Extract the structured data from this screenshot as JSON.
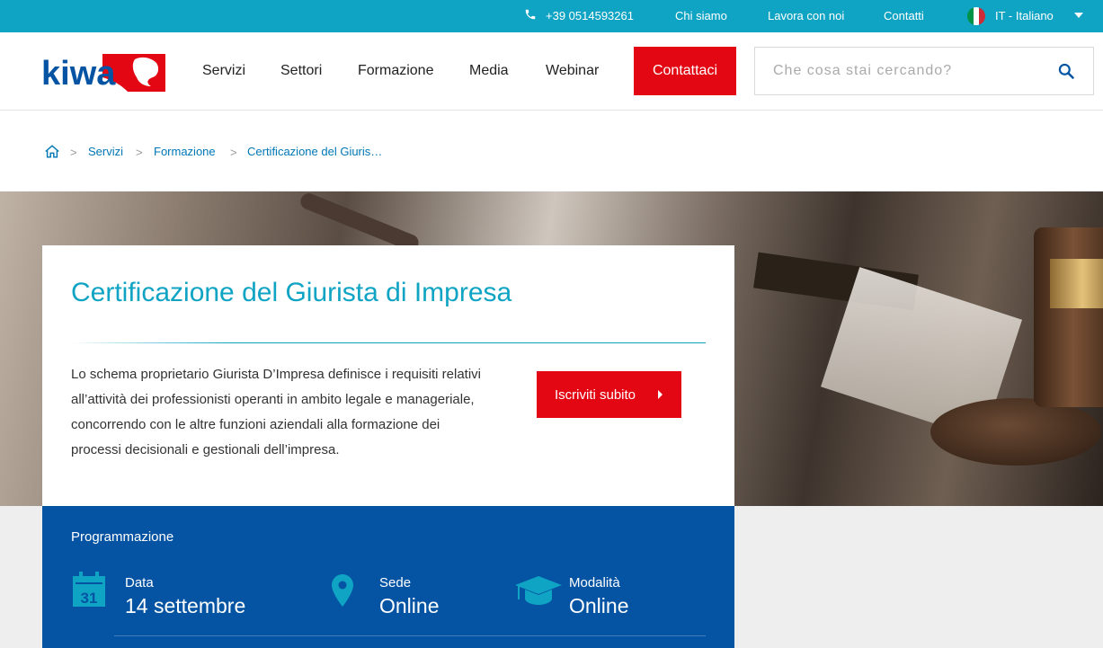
{
  "topbar": {
    "phone": "+39 0514593261",
    "links": [
      "Chi siamo",
      "Lavora con noi",
      "Contatti"
    ],
    "language": "IT - Italiano"
  },
  "header": {
    "logo_text": "kiwa",
    "nav": [
      "Servizi",
      "Settori",
      "Formazione",
      "Media",
      "Webinar"
    ],
    "contact_label": "Contattaci",
    "search_placeholder": "Che cosa stai cercando?",
    "search_value": ""
  },
  "breadcrumb": {
    "items": [
      "Servizi",
      "Formazione",
      "Certificazione del Giuris…"
    ],
    "separator": ">"
  },
  "hero": {
    "title": "Certificazione del Giurista di Impresa",
    "description": "Lo schema proprietario Giurista D’Impresa definisce i requisiti relativi all’attività dei professionisti operanti in ambito legale e manageriale, concorrendo con le altre funzioni aziendali alla formazione dei processi decisionali e gestionali dell’impresa.",
    "cta_label": "Iscriviti subito"
  },
  "schedule": {
    "heading": "Programmazione",
    "items": [
      {
        "label": "Data",
        "value": "14 settembre",
        "icon": "calendar-icon",
        "icon_text": "31"
      },
      {
        "label": "Sede",
        "value": "Online",
        "icon": "location-pin-icon"
      },
      {
        "label": "Modalità",
        "value": "Online",
        "icon": "graduation-cap-icon"
      }
    ]
  },
  "colors": {
    "topbar": "#0fa3c4",
    "accent_red": "#e30613",
    "title_blue": "#0fa3c4",
    "link_blue": "#0077b6",
    "schedule_blue": "#0454a3"
  }
}
